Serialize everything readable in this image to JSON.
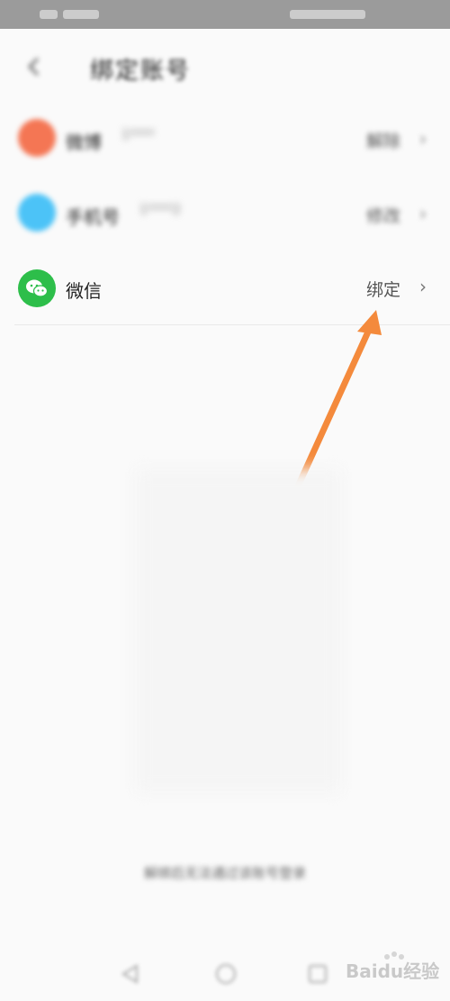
{
  "header": {
    "title": "绑定账号"
  },
  "accounts": [
    {
      "name": "微博",
      "value": "1****",
      "action": "解除",
      "color": "#f47654",
      "icon": "weibo-icon"
    },
    {
      "name": "手机号",
      "value": "1****2",
      "action": "修改",
      "color": "#4cc3f7",
      "icon": "phone-icon"
    },
    {
      "name": "微信",
      "value": "",
      "action": "绑定",
      "color": "#2dbe4a",
      "icon": "wechat-icon"
    }
  ],
  "footer": {
    "text": "解绑后无法通过该账号登录"
  },
  "annotation": {
    "arrow_color": "#f48a3c"
  },
  "watermark": {
    "text": "Baidu经验"
  }
}
